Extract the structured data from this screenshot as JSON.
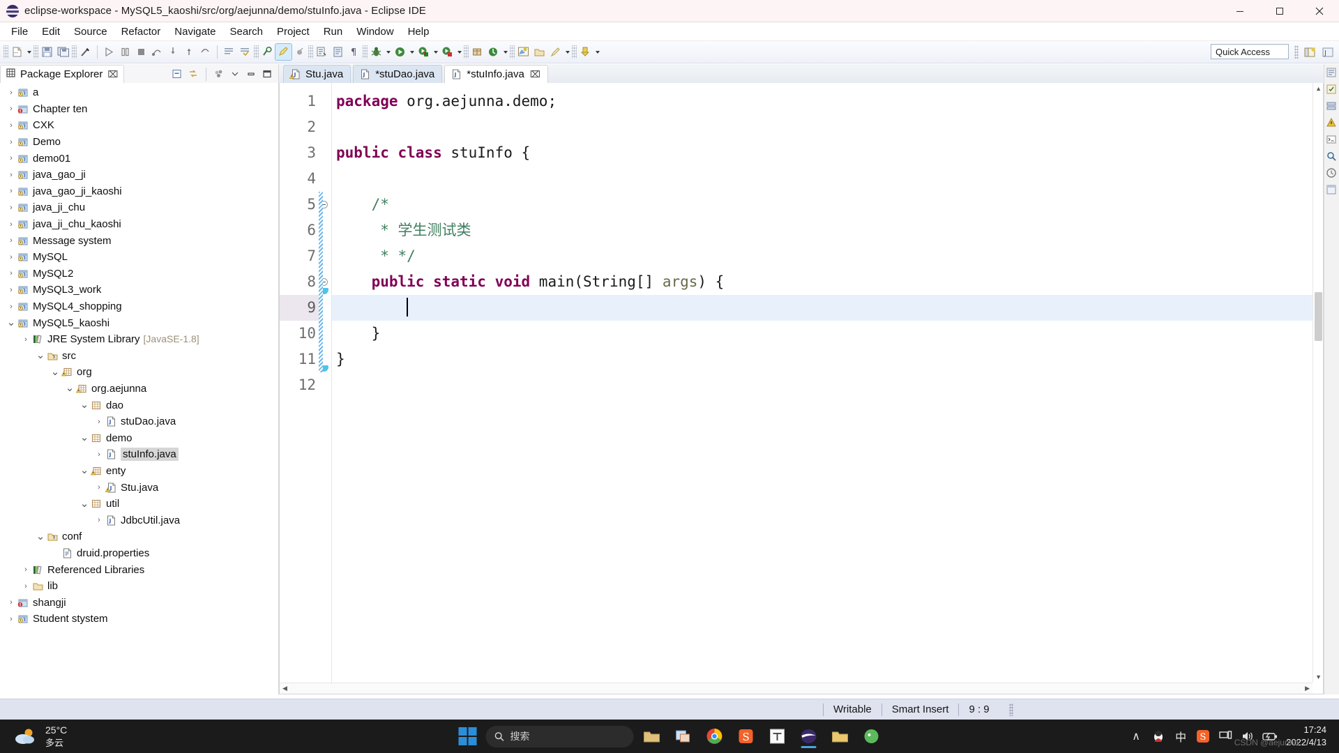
{
  "window": {
    "title": "eclipse-workspace - MySQL5_kaoshi/src/org/aejunna/demo/stuInfo.java - Eclipse IDE",
    "minimize_label": "−",
    "maximize_label": "□",
    "close_label": "✕"
  },
  "menu": {
    "items": [
      "File",
      "Edit",
      "Source",
      "Refactor",
      "Navigate",
      "Search",
      "Project",
      "Run",
      "Window",
      "Help"
    ]
  },
  "toolbar": {
    "quick_access_placeholder": "Quick Access"
  },
  "explorer": {
    "tab_label": "Package Explorer",
    "tab_close": "⌧",
    "tree": [
      {
        "label": "a",
        "depth": 0,
        "twist": "collapsed",
        "icon": "java-project-icon"
      },
      {
        "label": "Chapter ten",
        "depth": 0,
        "twist": "collapsed",
        "icon": "java-project-error-icon"
      },
      {
        "label": "CXK",
        "depth": 0,
        "twist": "collapsed",
        "icon": "java-project-icon"
      },
      {
        "label": "Demo",
        "depth": 0,
        "twist": "collapsed",
        "icon": "java-project-icon"
      },
      {
        "label": "demo01",
        "depth": 0,
        "twist": "collapsed",
        "icon": "java-project-icon"
      },
      {
        "label": "java_gao_ji",
        "depth": 0,
        "twist": "collapsed",
        "icon": "java-project-icon"
      },
      {
        "label": "java_gao_ji_kaoshi",
        "depth": 0,
        "twist": "collapsed",
        "icon": "java-project-icon"
      },
      {
        "label": "java_ji_chu",
        "depth": 0,
        "twist": "collapsed",
        "icon": "java-project-icon"
      },
      {
        "label": "java_ji_chu_kaoshi",
        "depth": 0,
        "twist": "collapsed",
        "icon": "java-project-icon"
      },
      {
        "label": "Message system",
        "depth": 0,
        "twist": "collapsed",
        "icon": "java-project-icon"
      },
      {
        "label": "MySQL",
        "depth": 0,
        "twist": "collapsed",
        "icon": "java-project-icon"
      },
      {
        "label": "MySQL2",
        "depth": 0,
        "twist": "collapsed",
        "icon": "java-project-icon"
      },
      {
        "label": "MySQL3_work",
        "depth": 0,
        "twist": "collapsed",
        "icon": "java-project-icon"
      },
      {
        "label": "MySQL4_shopping",
        "depth": 0,
        "twist": "collapsed",
        "icon": "java-project-icon"
      },
      {
        "label": "MySQL5_kaoshi",
        "depth": 0,
        "twist": "expanded",
        "icon": "java-project-icon"
      },
      {
        "label": "JRE System Library",
        "sub": "[JavaSE-1.8]",
        "depth": 1,
        "twist": "collapsed",
        "icon": "library-icon"
      },
      {
        "label": "src",
        "depth": 2,
        "twist": "expanded",
        "icon": "source-folder-icon"
      },
      {
        "label": "org",
        "depth": 3,
        "twist": "expanded",
        "icon": "package-warning-icon"
      },
      {
        "label": "org.aejunna",
        "depth": 4,
        "twist": "expanded",
        "icon": "package-warning-icon"
      },
      {
        "label": "dao",
        "depth": 5,
        "twist": "expanded",
        "icon": "package-icon"
      },
      {
        "label": "stuDao.java",
        "depth": 6,
        "twist": "collapsed",
        "icon": "java-file-icon"
      },
      {
        "label": "demo",
        "depth": 5,
        "twist": "expanded",
        "icon": "package-icon"
      },
      {
        "label": "stuInfo.java",
        "depth": 6,
        "twist": "collapsed",
        "icon": "java-file-icon",
        "selected": true
      },
      {
        "label": "enty",
        "depth": 5,
        "twist": "expanded",
        "icon": "package-warning-icon"
      },
      {
        "label": "Stu.java",
        "depth": 6,
        "twist": "collapsed",
        "icon": "java-file-warning-icon"
      },
      {
        "label": "util",
        "depth": 5,
        "twist": "expanded",
        "icon": "package-icon"
      },
      {
        "label": "JdbcUtil.java",
        "depth": 6,
        "twist": "collapsed",
        "icon": "java-file-icon"
      },
      {
        "label": "conf",
        "depth": 2,
        "twist": "expanded",
        "icon": "source-folder-icon"
      },
      {
        "label": "druid.properties",
        "depth": 3,
        "twist": "none",
        "icon": "properties-file-icon"
      },
      {
        "label": "Referenced Libraries",
        "depth": 1,
        "twist": "collapsed",
        "icon": "library-icon"
      },
      {
        "label": "lib",
        "depth": 1,
        "twist": "collapsed",
        "icon": "folder-icon"
      },
      {
        "label": "shangji",
        "depth": 0,
        "twist": "collapsed",
        "icon": "java-project-error-icon"
      },
      {
        "label": "Student stystem",
        "depth": 0,
        "twist": "collapsed",
        "icon": "java-project-icon"
      }
    ]
  },
  "editor": {
    "tabs": [
      {
        "label": "Stu.java",
        "active": false,
        "icon": "java-file-warning-icon",
        "close": ""
      },
      {
        "label": "*stuDao.java",
        "active": false,
        "icon": "java-file-icon",
        "close": ""
      },
      {
        "label": "*stuInfo.java",
        "active": true,
        "icon": "java-file-icon",
        "close": "⌧"
      }
    ],
    "line_numbers": [
      "1",
      "2",
      "3",
      "4",
      "5",
      "6",
      "7",
      "8",
      "9",
      "10",
      "11",
      "12"
    ],
    "current_line": 9,
    "code_lines": [
      {
        "n": 1,
        "tokens": [
          {
            "t": "package",
            "c": "kw"
          },
          {
            "t": " org.aejunna.demo;",
            "c": "plain"
          }
        ]
      },
      {
        "n": 2,
        "tokens": []
      },
      {
        "n": 3,
        "tokens": [
          {
            "t": "public class",
            "c": "kw"
          },
          {
            "t": " stuInfo {",
            "c": "plain"
          }
        ]
      },
      {
        "n": 4,
        "tokens": []
      },
      {
        "n": 5,
        "tokens": [
          {
            "t": "    /*",
            "c": "cmt"
          }
        ],
        "fold": "minus"
      },
      {
        "n": 6,
        "tokens": [
          {
            "t": "     * 学生测试类",
            "c": "cmt"
          }
        ]
      },
      {
        "n": 7,
        "tokens": [
          {
            "t": "     * */",
            "c": "cmt"
          }
        ]
      },
      {
        "n": 8,
        "tokens": [
          {
            "t": "    ",
            "c": "plain"
          },
          {
            "t": "public static void",
            "c": "kw"
          },
          {
            "t": " main(",
            "c": "plain"
          },
          {
            "t": "String",
            "c": "plain"
          },
          {
            "t": "[] ",
            "c": "plain"
          },
          {
            "t": "args",
            "c": "param"
          },
          {
            "t": ") {",
            "c": "plain"
          }
        ],
        "fold": "minus"
      },
      {
        "n": 9,
        "tokens": [
          {
            "t": "        ",
            "c": "plain"
          }
        ],
        "caret": true
      },
      {
        "n": 10,
        "tokens": [
          {
            "t": "    }",
            "c": "plain"
          }
        ]
      },
      {
        "n": 11,
        "tokens": [
          {
            "t": "}",
            "c": "plain"
          }
        ]
      },
      {
        "n": 12,
        "tokens": []
      }
    ]
  },
  "status": {
    "writable": "Writable",
    "insert_mode": "Smart Insert",
    "position": "9 : 9"
  },
  "taskbar": {
    "weather_temp": "25°C",
    "weather_desc": "多云",
    "search_placeholder": "搜索",
    "time": "17:24",
    "date": "2022/4/13",
    "ime_label": "中",
    "watermark": "CSDN @aejunna",
    "expand_label": "∧"
  },
  "colors": {
    "keyword": "#7f0055",
    "comment": "#3f7f5f",
    "selection": "#e8f1fb",
    "accent": "#2c8ed8"
  }
}
